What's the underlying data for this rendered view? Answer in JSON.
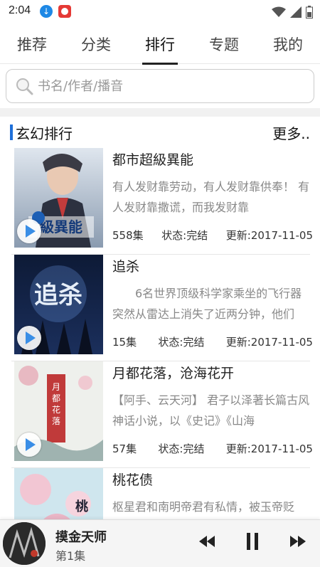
{
  "status_bar": {
    "time": "2:04"
  },
  "tabs": [
    {
      "label": "推荐"
    },
    {
      "label": "分类"
    },
    {
      "label": "排行"
    },
    {
      "label": "专题"
    },
    {
      "label": "我的"
    }
  ],
  "active_tab": "排行",
  "search": {
    "placeholder": "书名/作者/播音"
  },
  "section": {
    "title": "玄幻排行",
    "more": "更多.."
  },
  "books": [
    {
      "title": "都市超級異能",
      "desc": "有人发财靠劳动，有人发财靠供奉！ 有人发财靠撒谎，而我发财靠",
      "episodes": "558集",
      "status": "状态:完结",
      "updated": "更新:2017-11-05",
      "cover_text": "都市超級異能"
    },
    {
      "title": "追杀",
      "desc": "6名世界顶级科学家乘坐的飞行器突然从雷达上消失了近两分钟，他们",
      "episodes": "15集",
      "status": "状态:完结",
      "updated": "更新:2017-11-05",
      "cover_text": "追杀"
    },
    {
      "title": "月都花落，沧海花开",
      "desc": "【阿手、云天河】 君子以泽著长篇古风神话小说，以《史记》《山海",
      "episodes": "57集",
      "status": "状态:完结",
      "updated": "更新:2017-11-05",
      "cover_text": "月都花落"
    },
    {
      "title": "桃花债",
      "desc": "枢星君和南明帝君有私情，被玉帝贬",
      "episodes": "",
      "status": "",
      "updated": "",
      "cover_text": "桃花"
    }
  ],
  "player": {
    "title": "摸金天师",
    "episode": "第1集"
  },
  "colors": {
    "accent": "#1e6fd9",
    "play": "#3a8ee6"
  }
}
